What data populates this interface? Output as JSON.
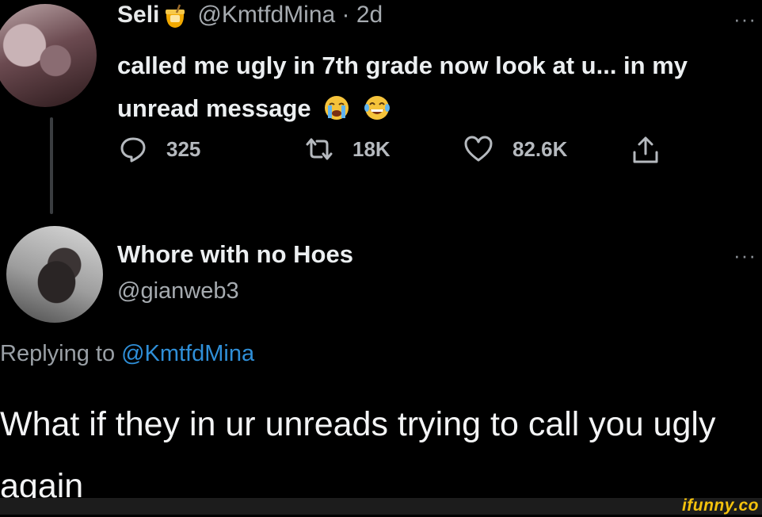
{
  "tweet1": {
    "display_name": "Seli",
    "name_emoji": "honey-pot-icon",
    "handle_time": "@KmtfdMina · 2d",
    "text": "called me ugly in 7th grade now look at u... in my unread message",
    "emojis": [
      "loudly-crying-face-icon",
      "tears-of-joy-face-icon"
    ],
    "actions": {
      "replies": "325",
      "retweets": "18K",
      "likes": "82.6K"
    }
  },
  "tweet2": {
    "display_name": "Whore with no Hoes",
    "handle": "@gianweb3",
    "replying_prefix": "Replying to",
    "replying_mention": "@KmtfdMina",
    "text": "What if they in ur unreads trying to call you ugly again"
  },
  "more_label": "···",
  "watermark": "ifunny.co",
  "colors": {
    "background": "#000000",
    "text": "#e7e9ea",
    "secondary": "#a6abb0",
    "link": "#2f8fd8",
    "watermark": "#f4c20d"
  }
}
